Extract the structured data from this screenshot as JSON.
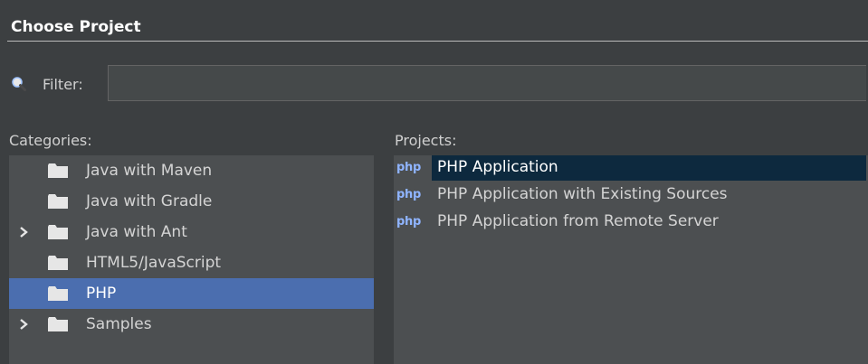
{
  "window": {
    "title": "Choose Project"
  },
  "filter": {
    "label": "Filter:",
    "value": "",
    "placeholder": ""
  },
  "categories": {
    "label": "Categories:",
    "items": [
      {
        "label": "Java with Maven",
        "expandable": false,
        "selected": false
      },
      {
        "label": "Java with Gradle",
        "expandable": false,
        "selected": false
      },
      {
        "label": "Java with Ant",
        "expandable": true,
        "selected": false
      },
      {
        "label": "HTML5/JavaScript",
        "expandable": false,
        "selected": false
      },
      {
        "label": "PHP",
        "expandable": false,
        "selected": true
      },
      {
        "label": "Samples",
        "expandable": true,
        "selected": false
      }
    ]
  },
  "projects": {
    "label": "Projects:",
    "items": [
      {
        "icon_text": "php",
        "label": "PHP Application",
        "selected": true
      },
      {
        "icon_text": "php",
        "label": "PHP Application with Existing Sources",
        "selected": false
      },
      {
        "icon_text": "php",
        "label": "PHP Application from Remote Server",
        "selected": false
      }
    ]
  },
  "colors": {
    "background": "#3c3f41",
    "panel": "#4c4f51",
    "selection": "#4b6eaf",
    "project_selection": "#0d293e",
    "php_icon": "#8fb4ff"
  }
}
